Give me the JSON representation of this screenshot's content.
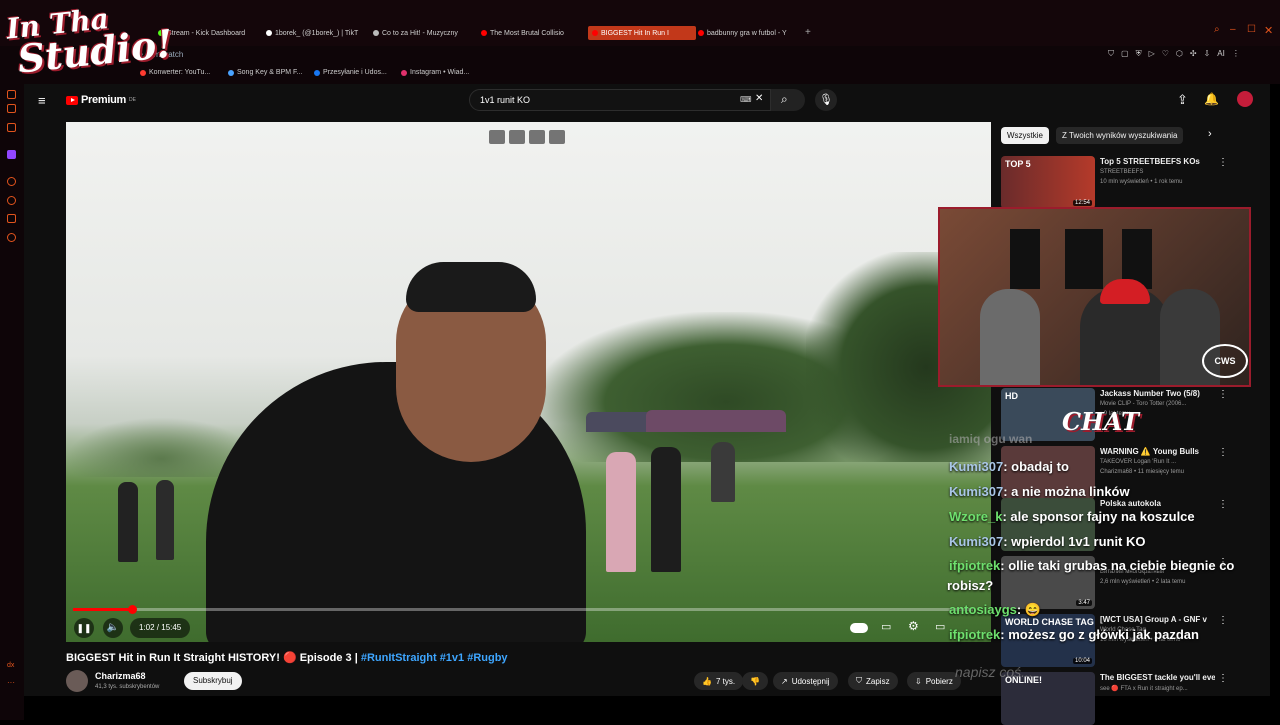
{
  "browser": {
    "tabs": [
      {
        "label": "Stream - Kick Dashboard",
        "color": "#53fc18"
      },
      {
        "label": "1borek_ (@1borek_) | TikT",
        "color": "#ffffff"
      },
      {
        "label": "Co to za Hit! - Muzyczny",
        "color": "#bbbbbb"
      },
      {
        "label": "The Most Brutal Collisio",
        "color": "#ff0000"
      },
      {
        "label": "BIGGEST Hit In Run I",
        "color": "#ff0000"
      },
      {
        "label": "badbunny gra w futbol - Y",
        "color": "#ff0000"
      }
    ],
    "url": "be.com/watch",
    "bookmarks": [
      "Konwerter: YouTu...",
      "Song Key & BPM F...",
      "Przesyłanie i Udos...",
      "Instagram • Wiad..."
    ],
    "ai_label": "AI",
    "sidebar_bottom": "dx"
  },
  "overlay": {
    "logo_line1": "In Tha",
    "logo_line2": "Studio!",
    "chat_title": "CHAT",
    "cws": "CWS",
    "chat_input": "napisz coś..."
  },
  "youtube": {
    "logo_text": "Premium",
    "logo_sup": "DE",
    "search_value": "1v1 runit KO",
    "player": {
      "time": "1:02 / 15:45",
      "progress": 0.066
    },
    "video_title": "BIGGEST Hit in Run It Straight HISTORY! 🔴 Episode 3 |",
    "hashtags": "#RunItStraight #1v1 #Rugby",
    "channel": "Charizma68",
    "subs": "41,3 tys. subskrybentów",
    "subscribe": "Subskrybuj",
    "actions": {
      "likes": "7 tys.",
      "share": "Udostępnij",
      "save": "Zapisz",
      "download": "Pobierz"
    },
    "chips": [
      "Wszystkie",
      "Z Twoich wyników wyszukiwania"
    ],
    "recommendations": [
      {
        "title": "Top 5 STREETBEEFS KOs",
        "channel": "STREETBEEFS",
        "meta": "10 mln wyświetleń • 1 rok temu",
        "duration": "12:54",
        "thumb_text": "TOP 5"
      },
      {
        "title": "Jackass Number Two (5/8)",
        "channel": "Movie CLIP - Toro Totter (2006...",
        "meta": "• 9 lat temu",
        "duration": "",
        "thumb_text": "HD"
      },
      {
        "title": "WARNING ⚠️ Young Bulls",
        "channel": "TAKEOVER Logan 'Run It ...",
        "meta": "Charizma68 • 11 miesięcy temu",
        "duration": "",
        "thumb_text": ""
      },
      {
        "title": "Polska autokola",
        "channel": "",
        "meta": "",
        "duration": "",
        "thumb_text": ""
      },
      {
        "title": "",
        "channel": "Виталий многократный",
        "meta": "2,6 mln wyświetleń • 2 lata temu",
        "duration": "3:47",
        "thumb_text": ""
      },
      {
        "title": "[WCT USA] Group A - GNF v",
        "channel": "World Chase Tag",
        "meta": "18 mln wyświetleń • 5 lat temu",
        "duration": "10:04",
        "thumb_text": "WORLD CHASE TAG"
      },
      {
        "title": "The BIGGEST tackle you'll ever",
        "channel": "see 🔴 FTA x Run it straight ep...",
        "meta": "",
        "duration": "",
        "thumb_text": "ONLINE!"
      }
    ]
  },
  "chat": {
    "partial_top": "iamiq ogu wan",
    "messages": [
      {
        "user": "Kumi307",
        "text": ": obadaj to",
        "color": "blue"
      },
      {
        "user": "Kumi307",
        "text": ": a nie można linków",
        "color": "blue"
      },
      {
        "user": "Wzore_k",
        "text": ": ale sponsor fajny na koszulce",
        "color": "green"
      },
      {
        "user": "Kumi307",
        "text": ": wpierdol 1v1 runit KO",
        "color": "blue"
      },
      {
        "user": "ifpiotrek",
        "text": ": ollie taki grubas na ciebie biegnie co",
        "color": "green"
      },
      {
        "user": "",
        "text": "robisz?",
        "color": "none"
      },
      {
        "user": "antosiaygs",
        "text": ": 😄",
        "color": "green"
      },
      {
        "user": "ifpiotrek",
        "text": ": możesz go z główki jak pazdan",
        "color": "green"
      }
    ]
  },
  "colors": {
    "accent": "#ff0000",
    "brand_orange": "#e2541d"
  }
}
